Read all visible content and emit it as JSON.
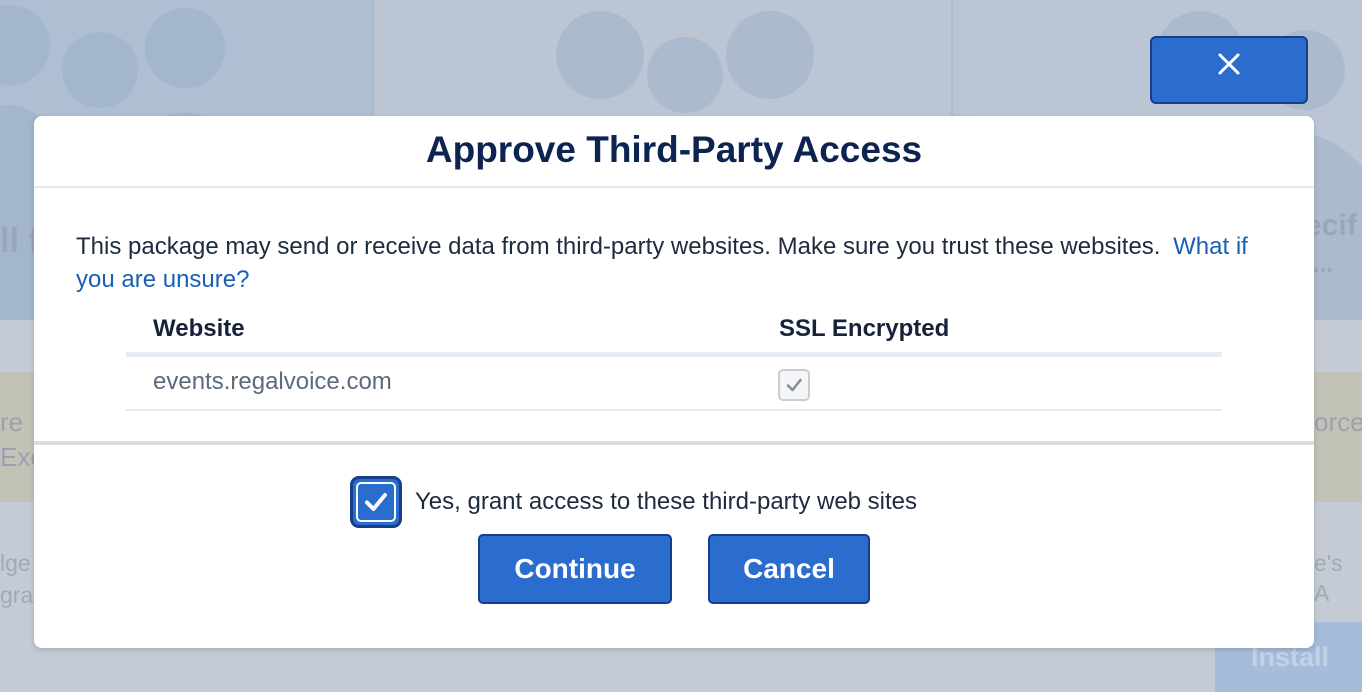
{
  "background": {
    "left_fragments": [
      "ll f",
      "re",
      "Exe",
      "lge",
      "gra"
    ],
    "right_fragments": [
      "ecif",
      "...",
      "orce",
      "e's A"
    ],
    "install_label": "Install"
  },
  "close_button": {
    "icon": "close-icon"
  },
  "modal": {
    "title": "Approve Third-Party Access",
    "description": "This package may send or receive data from third-party websites. Make sure you trust these websites.",
    "help_link": "What if you are unsure?",
    "table": {
      "headers": {
        "website": "Website",
        "ssl": "SSL Encrypted"
      },
      "rows": [
        {
          "website": "events.regalvoice.com",
          "ssl_encrypted": true
        }
      ]
    },
    "grant_checkbox": {
      "label": "Yes, grant access to these third-party web sites",
      "checked": true
    },
    "buttons": {
      "continue": "Continue",
      "cancel": "Cancel"
    }
  },
  "colors": {
    "accent": "#2b6ccf",
    "accent_border": "#163f8a",
    "title": "#0d2350",
    "link": "#1a5fb4"
  }
}
